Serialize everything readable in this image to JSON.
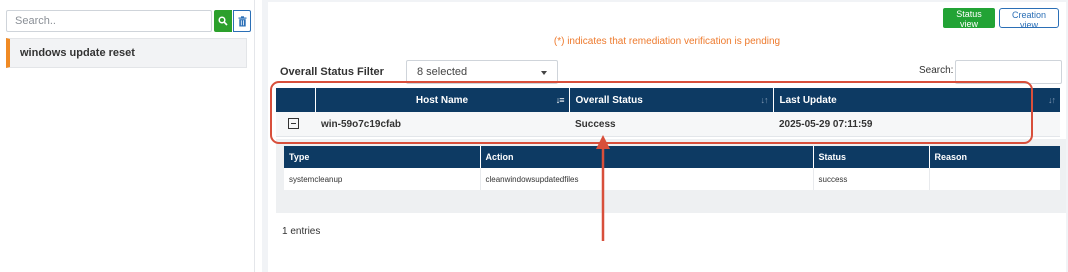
{
  "sidebar": {
    "search_placeholder": "Search..",
    "items": [
      {
        "label": "windows update reset"
      }
    ]
  },
  "toolbar": {
    "status_view_label": "Status view",
    "creation_view_label": "Creation view"
  },
  "pending_note": "(*) indicates that remediation verification is pending",
  "filter": {
    "label": "Overall Status Filter",
    "selected": "8 selected"
  },
  "table_search": {
    "label": "Search:",
    "value": ""
  },
  "table": {
    "columns": [
      "",
      "Host Name",
      "Overall Status",
      "Last Update"
    ],
    "rows": [
      {
        "host": "win-59o7c19cfab",
        "status": "Success",
        "last_update": "2025-05-29 07:11:59"
      }
    ]
  },
  "detail": {
    "columns": [
      "Type",
      "Action",
      "Status",
      "Reason"
    ],
    "rows": [
      {
        "type": "systemcleanup",
        "action": "cleanwindowsupdatedfiles",
        "status": "success",
        "reason": ""
      }
    ]
  },
  "entries_text": "1 entries",
  "colors": {
    "header_bg": "#0d3a63",
    "status_view_btn": "#22a335",
    "accent_orange": "#ee7a2d",
    "annotation_red": "#d84f3b"
  }
}
